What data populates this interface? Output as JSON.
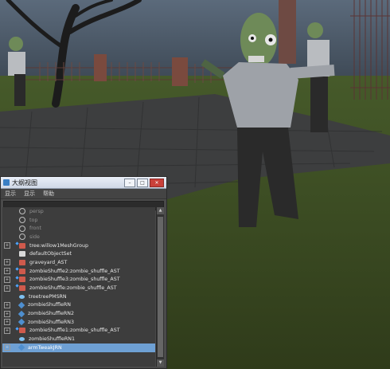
{
  "outliner": {
    "title": "大纲视图",
    "menu": [
      "显示",
      "显示",
      "帮助"
    ],
    "controls": {
      "minimize": "–",
      "maximize": "□",
      "close": "✕"
    },
    "search_placeholder": "",
    "rows": [
      {
        "label": "persp",
        "icon": "camera-icon",
        "dim": true,
        "expander": false,
        "ref": false
      },
      {
        "label": "top",
        "icon": "camera-icon",
        "dim": true,
        "expander": false,
        "ref": false
      },
      {
        "label": "front",
        "icon": "camera-icon",
        "dim": true,
        "expander": false,
        "ref": false
      },
      {
        "label": "side",
        "icon": "camera-icon",
        "dim": true,
        "expander": false,
        "ref": false
      },
      {
        "label": "tree:willow1MeshGroup",
        "icon": "group-icon",
        "dim": false,
        "expander": true,
        "ref": true
      },
      {
        "label": "defaultObjectSet",
        "icon": "set-icon",
        "dim": false,
        "expander": false,
        "ref": false
      },
      {
        "label": "graveyard_AST",
        "icon": "group-icon",
        "dim": false,
        "expander": true,
        "ref": false
      },
      {
        "label": "zombieShuffle2:zombie_shuffle_AST",
        "icon": "group-icon",
        "dim": false,
        "expander": true,
        "ref": true
      },
      {
        "label": "zombieShuffle3:zombie_shuffle_AST",
        "icon": "group-icon",
        "dim": false,
        "expander": true,
        "ref": true
      },
      {
        "label": "zombieShuffle:zombie_shuffle_AST",
        "icon": "group-icon",
        "dim": false,
        "expander": true,
        "ref": true
      },
      {
        "label": "treetreePMSRN",
        "icon": "refnode-icon",
        "dim": false,
        "expander": false,
        "ref": false
      },
      {
        "label": "zombieShuffleRN",
        "icon": "diamond-icon",
        "dim": false,
        "expander": true,
        "ref": false
      },
      {
        "label": "zombieShuffleRN2",
        "icon": "diamond-icon",
        "dim": false,
        "expander": true,
        "ref": false
      },
      {
        "label": "zombieShuffleRN3",
        "icon": "diamond-icon",
        "dim": false,
        "expander": true,
        "ref": false
      },
      {
        "label": "zombieShuffle1:zombie_shuffle_AST",
        "icon": "group-icon",
        "dim": false,
        "expander": true,
        "ref": true
      },
      {
        "label": "zombieShuffleRN1",
        "icon": "refnode-icon",
        "dim": false,
        "expander": false,
        "ref": false
      },
      {
        "label": "armTweakJRN",
        "icon": "diamond-icon",
        "dim": false,
        "expander": true,
        "ref": false,
        "selected": true
      }
    ],
    "scroll": {
      "up": "▲",
      "down": "▼"
    }
  },
  "colors": {
    "sky": "#3e4a57",
    "grass": "#3b4a25",
    "path": "#3c3d3d",
    "selection": "#6ea0d4"
  }
}
